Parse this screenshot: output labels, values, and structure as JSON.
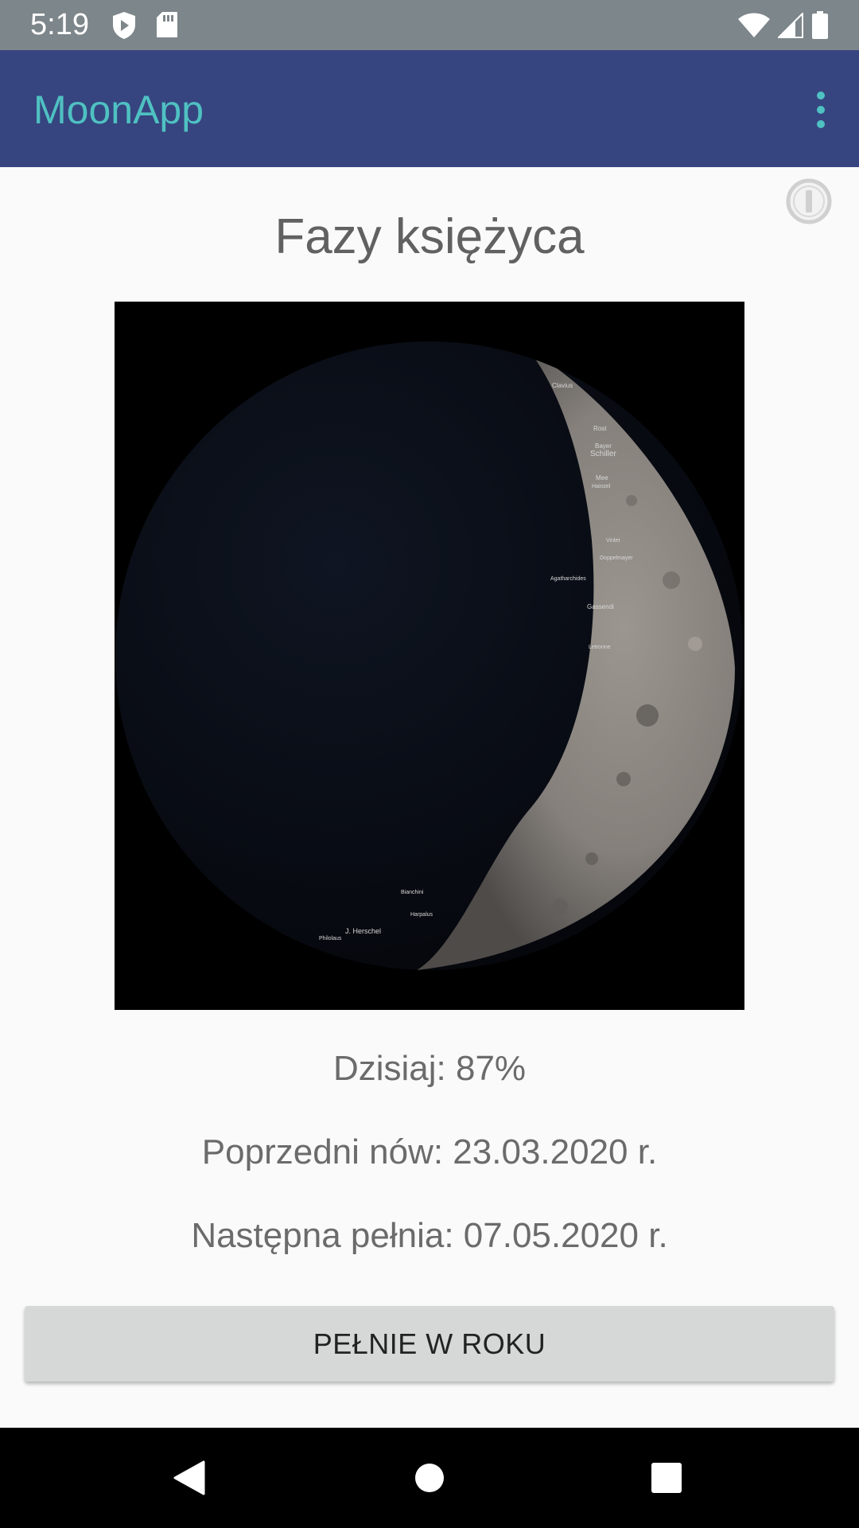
{
  "status_bar": {
    "time": "5:19",
    "icons": [
      "shield-play-icon",
      "sd-card-icon",
      "wifi-icon",
      "signal-icon",
      "battery-icon"
    ],
    "background": "#7d868a"
  },
  "app_bar": {
    "title": "MoonApp",
    "title_color": "#4fc1c2",
    "background": "#36457f",
    "menu_icon": "more-vert-icon"
  },
  "info_icon": "info-icon",
  "main": {
    "title": "Fazy księżyca",
    "moon_image": {
      "labels": [
        "Clavius",
        "Rost",
        "Bayer",
        "Schiller",
        "Mee",
        "Hainzel",
        "Vinlet",
        "Doppelmayer",
        "Agatharchides",
        "Gassendi",
        "Letronne",
        "Bianchini",
        "Harpalus",
        "J. Herschel",
        "Philolaus"
      ]
    },
    "today": "Dzisiaj: 87%",
    "previous_new_moon": "Poprzedni nów: 23.03.2020 r.",
    "next_full_moon": "Następna pełnia: 07.05.2020 r.",
    "button_label": "PEŁNIE W ROKU"
  },
  "nav_bar": {
    "icons": [
      "back-icon",
      "home-icon",
      "recents-icon"
    ]
  }
}
